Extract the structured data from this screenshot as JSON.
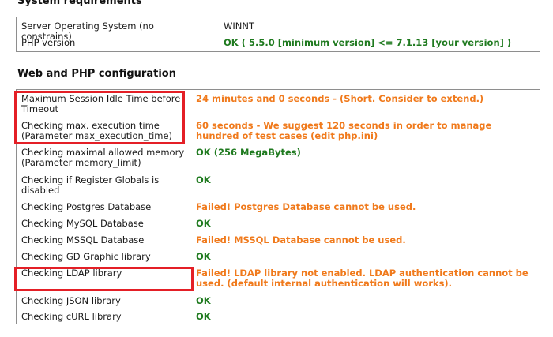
{
  "system_requirements": {
    "title": "System requirements",
    "rows": [
      {
        "label": "Server Operating System (no constrains)",
        "value": "WINNT"
      },
      {
        "label": "PHP version",
        "value": "OK ( 5.5.0 [minimum version] <= 7.1.13 [your version] )"
      }
    ]
  },
  "web_php_config": {
    "title": "Web and PHP configuration",
    "rows": [
      {
        "label": "Maximum Session Idle Time before Timeout",
        "value": "24 minutes and 0 seconds - (Short. Consider to extend.)",
        "status": "warning"
      },
      {
        "label": "Checking max. execution time (Parameter max_execution_time)",
        "value": "60 seconds - We suggest 120 seconds in order to manage hundred of test cases (edit php.ini)",
        "status": "warning"
      },
      {
        "label": "Checking maximal allowed memory (Parameter memory_limit)",
        "value": "OK (256 MegaBytes)",
        "status": "ok"
      },
      {
        "label": "Checking if Register Globals is disabled",
        "value": "OK",
        "status": "ok"
      },
      {
        "label": "Checking Postgres Database",
        "value": "Failed! Postgres Database cannot be used.",
        "status": "failed"
      },
      {
        "label": "Checking MySQL Database",
        "value": "OK",
        "status": "ok"
      },
      {
        "label": "Checking MSSQL Database",
        "value": "Failed! MSSQL Database cannot be used.",
        "status": "failed"
      },
      {
        "label": "Checking GD Graphic library",
        "value": "OK",
        "status": "ok"
      },
      {
        "label": "Checking LDAP library",
        "value": "Failed! LDAP library not enabled. LDAP authentication cannot be used. (default internal authentication will works).",
        "status": "failed"
      },
      {
        "label": "Checking JSON library",
        "value": "OK",
        "status": "ok"
      },
      {
        "label": "Checking cURL library",
        "value": "OK",
        "status": "ok"
      }
    ]
  },
  "colors": {
    "ok": "#1f7a1f",
    "warning": "#f07a1c",
    "highlight": "#e41f26"
  }
}
